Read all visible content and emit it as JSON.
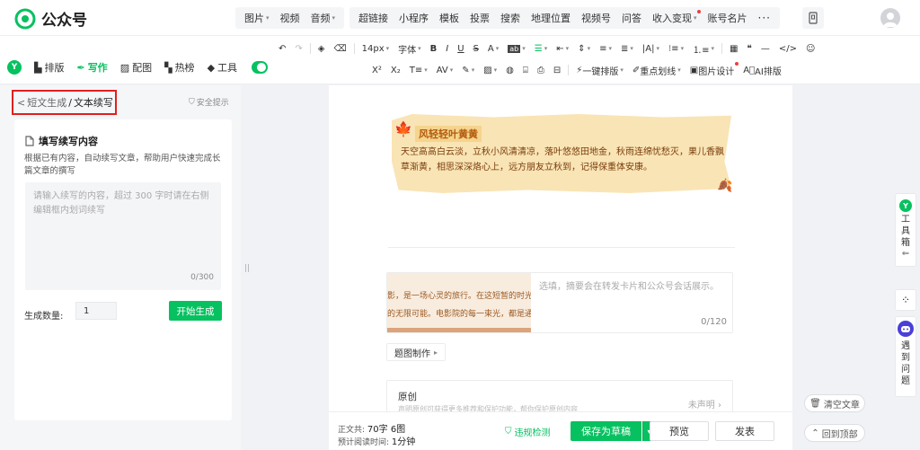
{
  "app": {
    "name": "公众号",
    "brand_color": "#07c160"
  },
  "insert_menu_1": [
    {
      "label": "图片",
      "caret": true
    },
    {
      "label": "视频",
      "caret": false
    },
    {
      "label": "音频",
      "caret": true
    }
  ],
  "insert_menu_2": [
    {
      "label": "超链接"
    },
    {
      "label": "小程序"
    },
    {
      "label": "模板"
    },
    {
      "label": "投票"
    },
    {
      "label": "搜索"
    },
    {
      "label": "地理位置"
    },
    {
      "label": "视频号"
    },
    {
      "label": "问答"
    },
    {
      "label": "收入变现",
      "caret": true,
      "dot": true
    },
    {
      "label": "账号名片"
    }
  ],
  "more_label": "···",
  "left_tabs": [
    {
      "label": "排版",
      "icon": "layout-icon"
    },
    {
      "label": "写作",
      "icon": "pen-icon",
      "active": true
    },
    {
      "label": "配图",
      "icon": "image-icon"
    },
    {
      "label": "热榜",
      "icon": "bookmark-icon"
    },
    {
      "label": "工具",
      "icon": "cube-icon"
    }
  ],
  "format_row1": {
    "font_size": "14px",
    "font_label": "字体",
    "buttons": [
      "B",
      "I",
      "U",
      "S",
      "A",
      "ab"
    ]
  },
  "format_row2": {
    "sup": "X²",
    "sub": "X₂",
    "onekey": "一键排版",
    "highlight": "重点划线",
    "imgdesign": "图片设计",
    "ai": "AI排版"
  },
  "breadcrumb": {
    "back": "<",
    "parent": "短文生成",
    "sep": "/",
    "current": "文本续写"
  },
  "safety_tip": "安全提示",
  "continue_card": {
    "title": "填写续写内容",
    "desc": "根据已有内容，自动续写文章，帮助用户快速完成长篇文章的撰写",
    "placeholder": "请输入续写的内容，超过 300 字时请在右侧编辑框内划词续写",
    "counter": "0/300",
    "count_label": "生成数量:",
    "count_value": "1",
    "generate": "开始生成"
  },
  "article": {
    "banner_title": "风轻轻叶黄黄",
    "banner_text": "天空高高白云淡，立秋小风清清凉，落叶悠悠田地金，秋雨连绵忧愁灭，果儿香飘草渐黄，相思深深烙心上，远方朋友立秋到，记得保重体安康。",
    "cover_line1": "影，是一场心灵的旅行。在这短暂的时光里",
    "cover_line2": "的无限可能。电影院的每一束光，都是通往",
    "digest_placeholder": "选填，摘要会在转发卡片和公众号会话展示。",
    "digest_count": "0/120",
    "cover_make": "题图制作",
    "original_label": "原创",
    "original_sub": "声明原创可获得更多推荐和保护功能，帮你保护原创内容",
    "original_status": "未声明"
  },
  "right_tools": {
    "toolbox": [
      "工",
      "具",
      "箱"
    ],
    "ask": [
      "遇",
      "到",
      "问",
      "题"
    ],
    "clear": "清空文章",
    "back_top": "回到顶部"
  },
  "bottom": {
    "words_label": "正文共:",
    "words_value": "70字 6图",
    "time_label": "预计阅读时间:",
    "time_value": "1分钟",
    "check": "违规检测",
    "save": "保存为草稿",
    "preview": "预览",
    "publish": "发表"
  }
}
